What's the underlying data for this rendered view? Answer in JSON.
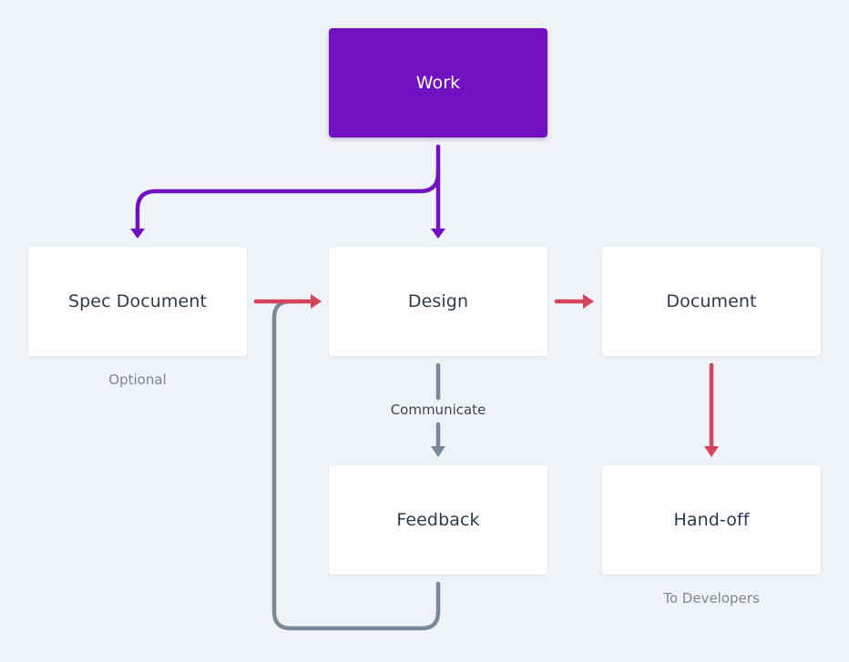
{
  "colors": {
    "background": "#eff2f6",
    "primary": "#7211c2",
    "red_edge": "#d4445a",
    "gray_edge": "#7a8898",
    "node_text": "#2d3a4b",
    "caption_text": "#7a8898"
  },
  "nodes": {
    "work": {
      "label": "Work"
    },
    "spec_document": {
      "label": "Spec Document",
      "caption": "Optional"
    },
    "design": {
      "label": "Design"
    },
    "document": {
      "label": "Document"
    },
    "feedback": {
      "label": "Feedback"
    },
    "hand_off": {
      "label": "Hand-off",
      "caption": "To Developers"
    }
  },
  "edges": [
    {
      "from": "Work",
      "to": "Spec Document",
      "color": "primary"
    },
    {
      "from": "Work",
      "to": "Design",
      "color": "primary"
    },
    {
      "from": "Spec Document",
      "to": "Design",
      "color": "red_edge"
    },
    {
      "from": "Design",
      "to": "Document",
      "color": "red_edge"
    },
    {
      "from": "Document",
      "to": "Hand-off",
      "color": "red_edge"
    },
    {
      "from": "Design",
      "to": "Feedback",
      "color": "gray_edge",
      "label": "Communicate"
    },
    {
      "from": "Feedback",
      "to": "Design",
      "color": "gray_edge"
    }
  ],
  "edge_labels": {
    "communicate": "Communicate"
  }
}
